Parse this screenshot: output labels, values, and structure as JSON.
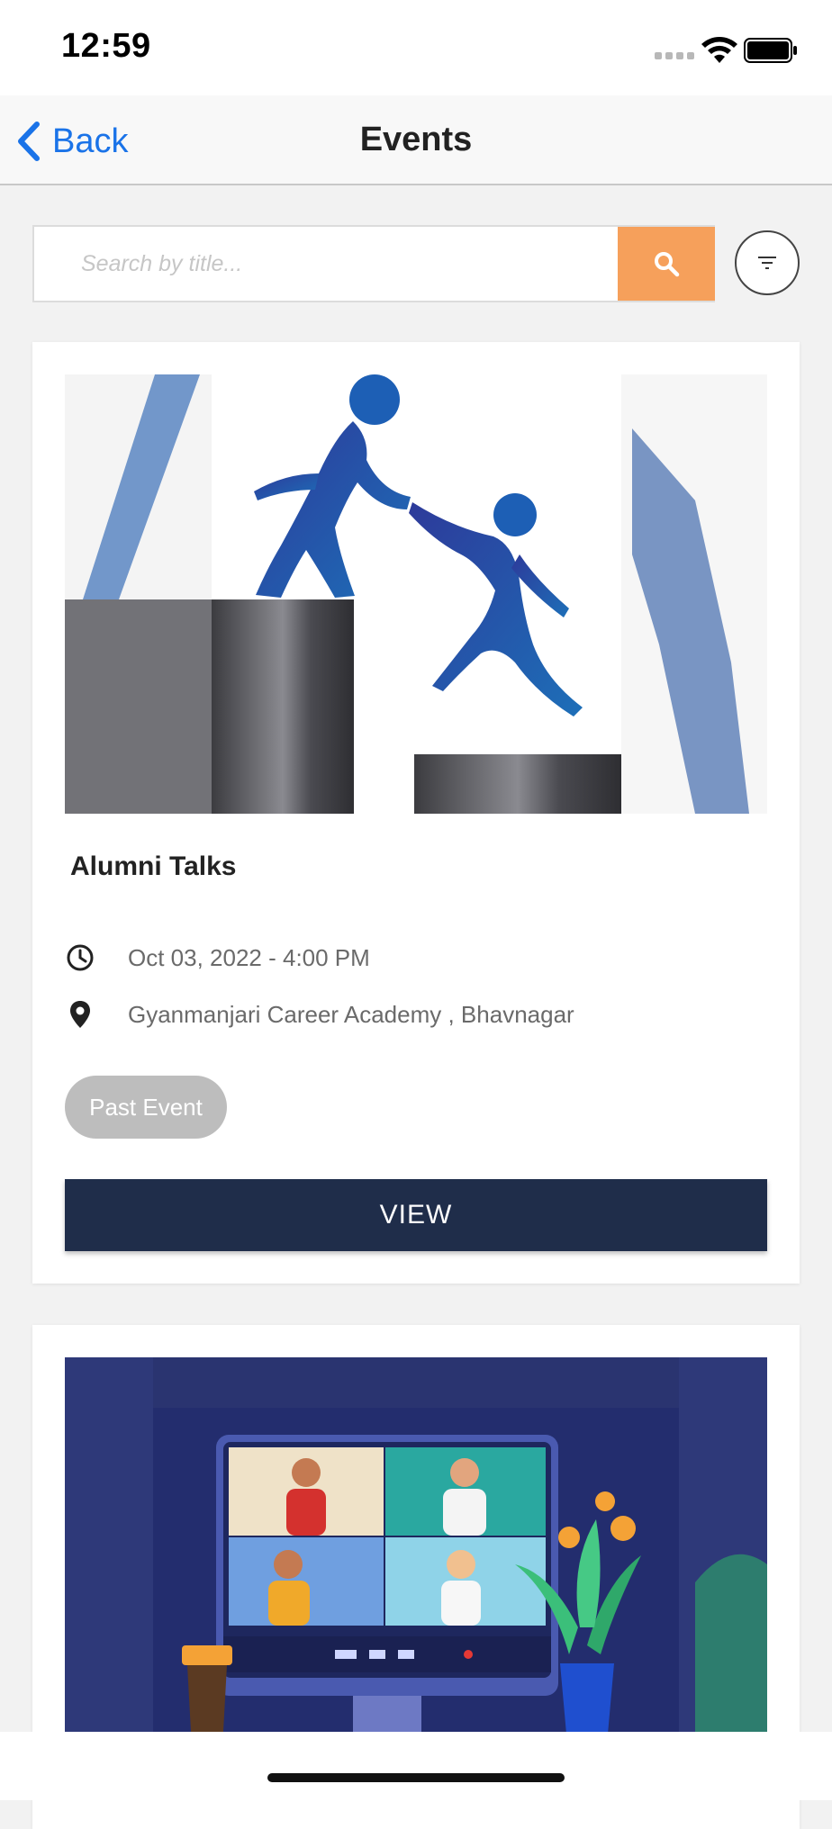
{
  "status_bar": {
    "time": "12:59",
    "icons": [
      "cellular-signal-icon",
      "wifi-icon",
      "battery-icon"
    ]
  },
  "nav": {
    "back_label": "Back",
    "title": "Events",
    "back_icon": "chevron-left-icon"
  },
  "search": {
    "placeholder": "Search by title...",
    "value": "",
    "button_icon": "search-icon",
    "filter_icon": "filter-icon"
  },
  "events": [
    {
      "title": "Alumni Talks",
      "datetime": "Oct 03, 2022 - 4:00 PM",
      "location": "Gyanmanjari Career Academy , Bhavnagar",
      "badge": "Past Event",
      "action_label": "VIEW",
      "image": "helping-hand-climb-illustration"
    },
    {
      "image": "video-conference-illustration"
    }
  ],
  "colors": {
    "accent_orange": "#f6a05b",
    "navy_button": "#1f2d4a",
    "link_blue": "#1a73e8",
    "badge_gray": "#bdbdbd"
  }
}
